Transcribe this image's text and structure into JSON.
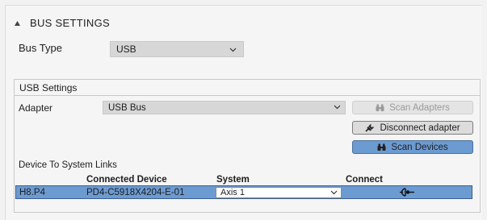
{
  "section": {
    "title": "BUS SETTINGS",
    "collapse_icon": "collapse-triangle-icon"
  },
  "bus_type": {
    "label": "Bus Type",
    "value": "USB"
  },
  "usb_settings": {
    "header": "USB Settings",
    "adapter_label": "Adapter",
    "adapter_value": "USB Bus",
    "buttons": {
      "scan_adapters": "Scan Adapters",
      "disconnect_adapter": "Disconnect adapter",
      "scan_devices": "Scan Devices"
    },
    "links_label": "Device To System Links",
    "columns": {
      "device": "Connected Device",
      "system": "System",
      "connect": "Connect"
    },
    "rows": [
      {
        "id": "H8.P4",
        "device": "PD4-C5918X4204-E-01",
        "system": "Axis 1"
      }
    ]
  },
  "colors": {
    "accent": "#6c9bd2",
    "accent_border": "#3c5f8c",
    "dropdown_bg": "#d7d7d7",
    "panel_bg": "#f5f5f5"
  }
}
